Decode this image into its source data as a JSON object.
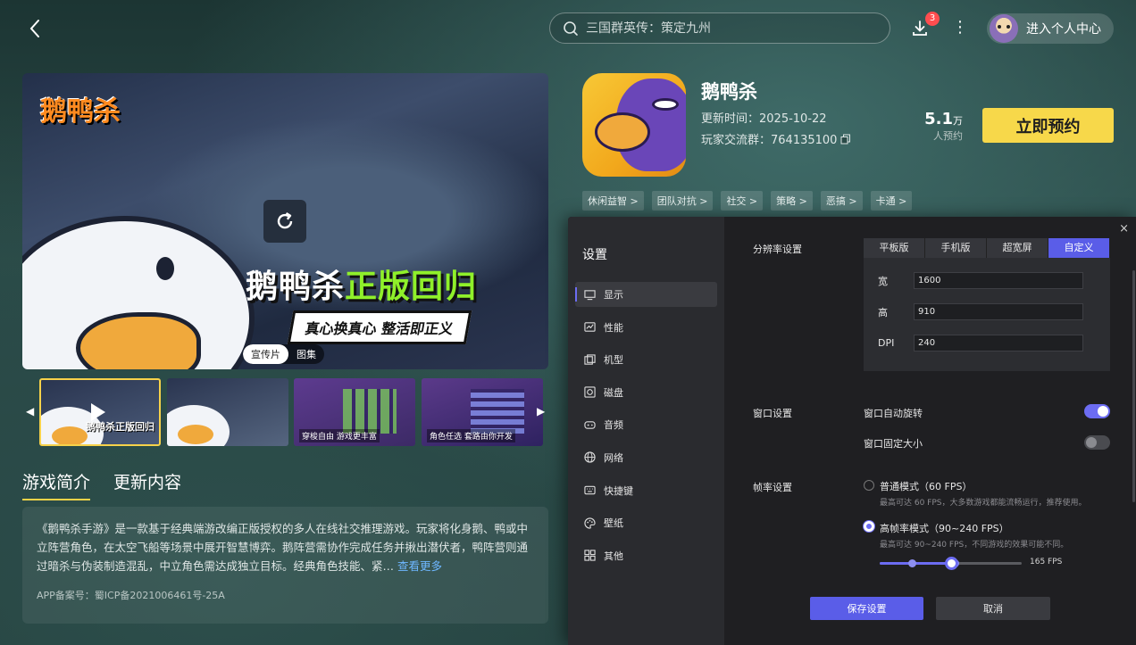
{
  "header": {
    "search_placeholder": "三国群英传：策定九州",
    "download_badge": "3",
    "more_glyph": "⋮",
    "user_center_label": "进入个人中心"
  },
  "media": {
    "logo_text": "鹅鸭杀",
    "slogan_white": "鹅鸭杀",
    "slogan_green": "正版回归",
    "sub_slogan": "真心换真心 整活即正义",
    "tabs": [
      {
        "label": "宣传片",
        "active": true
      },
      {
        "label": "图集",
        "active": false
      }
    ],
    "thumbnails": [
      {
        "caption": "鹅鸭杀正版回归",
        "type": "video",
        "selected": true
      },
      {
        "caption": "",
        "type": "image",
        "selected": false
      },
      {
        "caption": "穿梭自由 游戏更丰富",
        "type": "image",
        "selected": false
      },
      {
        "caption": "角色任选 套路由你开发",
        "type": "image",
        "selected": false
      }
    ]
  },
  "intro": {
    "tabs": [
      {
        "label": "游戏简介",
        "active": true
      },
      {
        "label": "更新内容",
        "active": false
      }
    ],
    "text": "《鹅鸭杀手游》是一款基于经典端游改编正版授权的多人在线社交推理游戏。玩家将化身鹅、鸭或中立阵营角色，在太空飞船等场景中展开智慧博弈。鹅阵营需协作完成任务并揪出潜伏者，鸭阵营则通过暗杀与伪装制造混乱，中立角色需达成独立目标。经典角色技能、紧…",
    "see_more": "查看更多",
    "icp": "APP备案号：蜀ICP备2021006461号-25A"
  },
  "app": {
    "title": "鹅鸭杀",
    "update_time": "更新时间：2025-10-22",
    "player_group": "玩家交流群：764135100",
    "reserve_num": "5.1",
    "reserve_unit": "万",
    "reserve_label": "人预约",
    "reserve_button": "立即预约",
    "tags": [
      "休闲益智 >",
      "团队对抗 >",
      "社交 >",
      "策略 >",
      "恶搞 >",
      "卡通 >"
    ]
  },
  "settings": {
    "title": "设置",
    "close_glyph": "×",
    "menu": [
      {
        "label": "显示",
        "icon": "monitor-icon",
        "active": true
      },
      {
        "label": "性能",
        "icon": "performance-icon",
        "active": false
      },
      {
        "label": "机型",
        "icon": "device-icon",
        "active": false
      },
      {
        "label": "磁盘",
        "icon": "disk-icon",
        "active": false
      },
      {
        "label": "音频",
        "icon": "audio-icon",
        "active": false
      },
      {
        "label": "网络",
        "icon": "network-icon",
        "active": false
      },
      {
        "label": "快捷键",
        "icon": "keyboard-icon",
        "active": false
      },
      {
        "label": "壁纸",
        "icon": "palette-icon",
        "active": false
      },
      {
        "label": "其他",
        "icon": "grid-icon",
        "active": false
      }
    ],
    "resolution": {
      "label": "分辨率设置",
      "tabs": [
        {
          "label": "平板版",
          "active": false
        },
        {
          "label": "手机版",
          "active": false
        },
        {
          "label": "超宽屏",
          "active": false
        },
        {
          "label": "自定义",
          "active": true
        }
      ],
      "width_label": "宽",
      "width_value": "1600",
      "height_label": "高",
      "height_value": "910",
      "dpi_label": "DPI",
      "dpi_value": "240"
    },
    "window": {
      "label": "窗口设置",
      "auto_rotate_label": "窗口自动旋转",
      "auto_rotate_on": true,
      "fixed_size_label": "窗口固定大小",
      "fixed_size_on": false
    },
    "framerate": {
      "label": "帧率设置",
      "normal_label": "普通模式（60 FPS）",
      "normal_hint": "最高可达 60 FPS，大多数游戏都能流畅运行，推荐使用。",
      "normal_checked": false,
      "high_label": "高帧率模式（90~240 FPS）",
      "high_hint": "最高可达 90~240 FPS，不同游戏的效果可能不同。",
      "high_checked": true,
      "slider_min": 90,
      "slider_max": 240,
      "slider_value": 165,
      "slider_value_label": "165 FPS"
    },
    "save_button": "保存设置",
    "cancel_button": "取消"
  },
  "colors": {
    "accent": "#5a5de8",
    "reserve_yellow": "#f7d84a",
    "badge_red": "#ff4d4f",
    "link_blue": "#6eb7ff"
  }
}
